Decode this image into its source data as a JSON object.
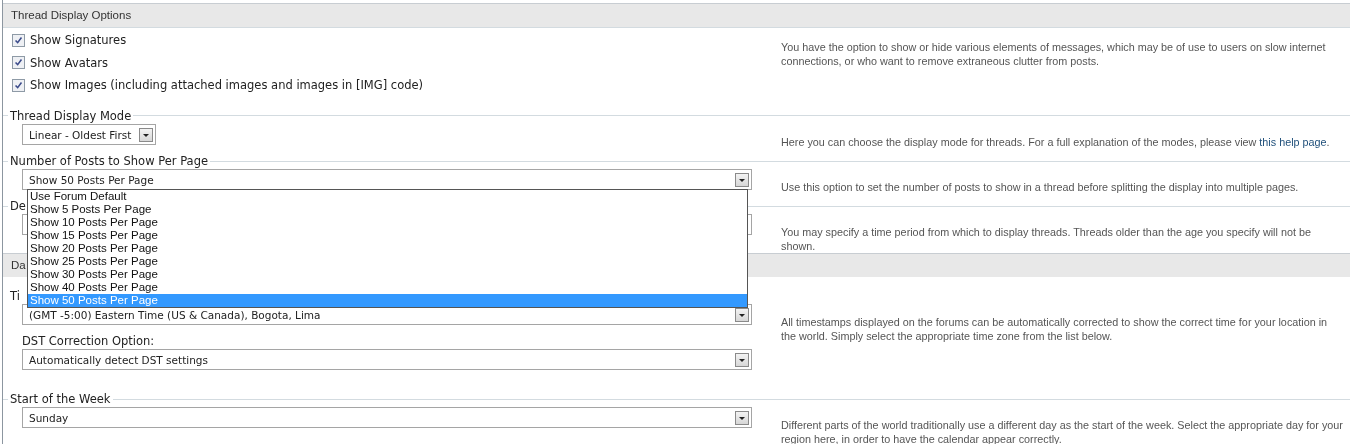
{
  "sections": [
    {
      "title": "Thread Display Options",
      "rows": [
        {
          "kind": "checkboxes",
          "checkboxes": [
            {
              "label": "Show Signatures",
              "checked": true
            },
            {
              "label": "Show Avatars",
              "checked": true
            },
            {
              "label": "Show Images (including attached images and images in [IMG] code)",
              "checked": true
            }
          ],
          "description": "You have the option to show or hide various elements of messages, which may be of use to users on slow internet connections, or who want to remove extraneous clutter from posts."
        },
        {
          "kind": "selects",
          "label": "Thread Display Mode",
          "fields": [
            {
              "kind": "short",
              "value": "Linear - Oldest First"
            }
          ],
          "description": "Here you can choose the display mode for threads. For a full explanation of the modes, please view ",
          "link": "this help page",
          "after_link": "."
        },
        {
          "kind": "selects",
          "label": "Number of Posts to Show Per Page",
          "fields": [
            {
              "kind": "wide",
              "value": "Show 50 Posts Per Page",
              "options": [
                {
                  "label": "Use Forum Default",
                  "selected": false
                },
                {
                  "label": "Show 5 Posts Per Page",
                  "selected": false
                },
                {
                  "label": "Show 10 Posts Per Page",
                  "selected": false
                },
                {
                  "label": "Show 15 Posts Per Page",
                  "selected": false
                },
                {
                  "label": "Show 20 Posts Per Page",
                  "selected": false
                },
                {
                  "label": "Show 25 Posts Per Page",
                  "selected": false
                },
                {
                  "label": "Show 30 Posts Per Page",
                  "selected": false
                },
                {
                  "label": "Show 40 Posts Per Page",
                  "selected": false
                },
                {
                  "label": "Show 50 Posts Per Page",
                  "selected": true
                }
              ]
            }
          ],
          "description": "Use this option to set the number of posts to show in a thread before splitting the display into multiple pages."
        },
        {
          "kind": "selects",
          "label": "De",
          "fields": [
            {
              "kind": "wide"
            }
          ],
          "description": "You may specify a time period from which to display threads. Threads older than the age you specify will not be shown."
        }
      ]
    },
    {
      "title": "Da",
      "rows": [
        {
          "kind": "selects",
          "label": "Ti",
          "fields": [
            {
              "kind": "wide",
              "value": "(GMT -5:00) Eastern Time (US & Canada), Bogota, Lima"
            },
            {
              "kind": "wide",
              "label": "DST Correction Option:",
              "value": "Automatically detect DST settings"
            }
          ],
          "description": "All timestamps displayed on the forums can be automatically corrected to show the correct time for your location in the world. Simply select the appropriate time zone from the list below."
        },
        {
          "kind": "selects",
          "label": "Start of the Week",
          "fields": [
            {
              "kind": "wide",
              "value": "Sunday"
            }
          ],
          "description": "Different parts of the world traditionally use a different day as the start of the week. Select the appropriate day for your region here, in order to have the calendar appear correctly."
        }
      ]
    }
  ]
}
